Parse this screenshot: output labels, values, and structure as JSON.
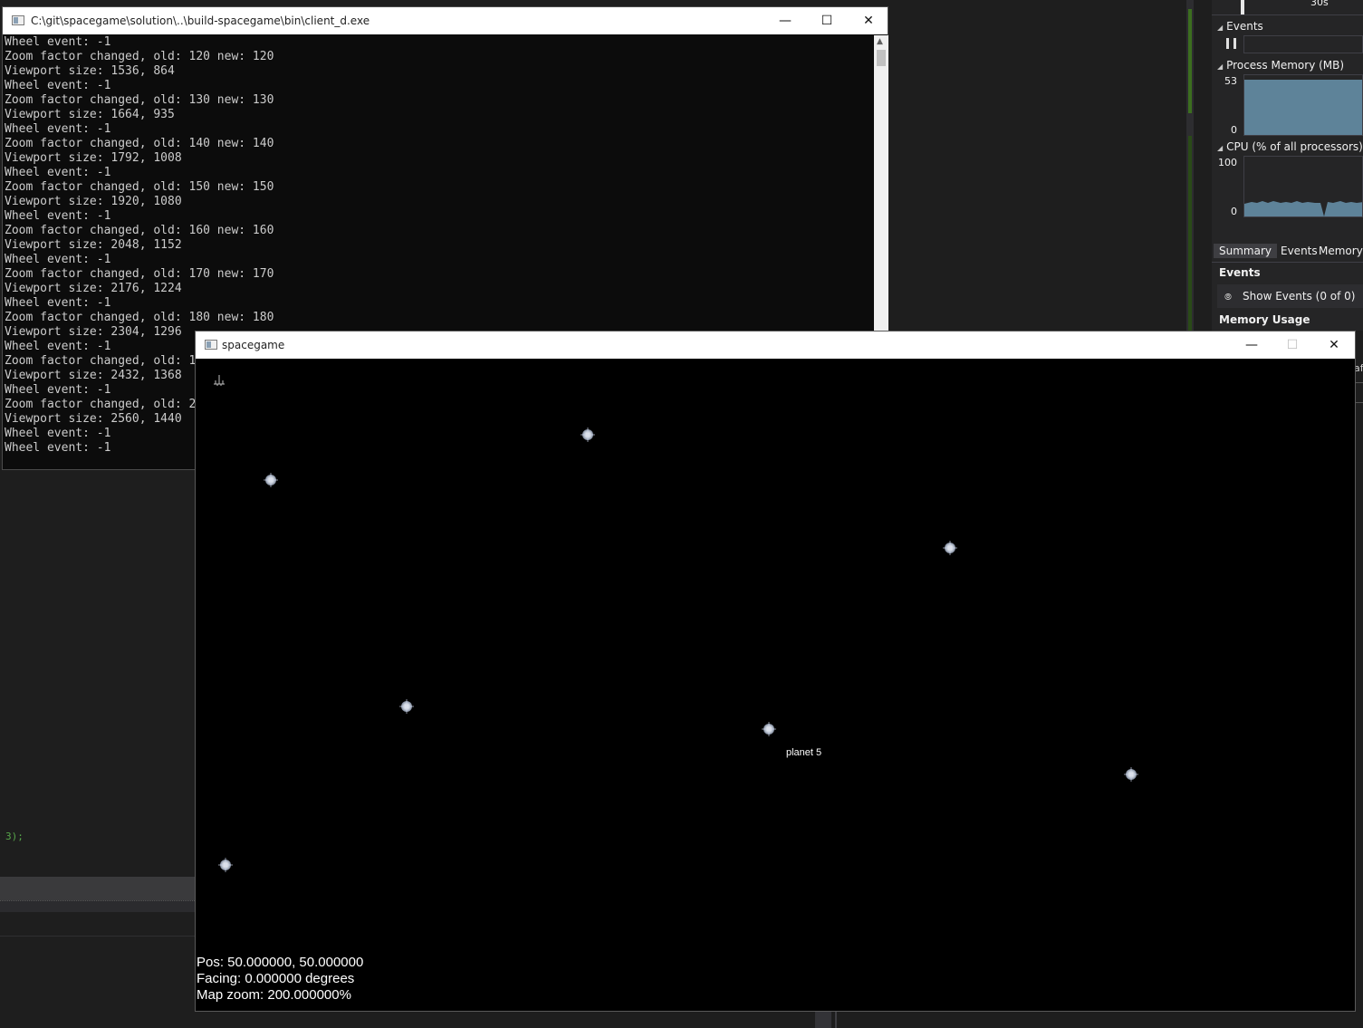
{
  "ide": {
    "code_fragment": "3);",
    "right_fragment": "af"
  },
  "diagnostics": {
    "timeline_label": "30s",
    "events_section": "Events",
    "process_memory": {
      "title": "Process Memory (MB)",
      "max": "53",
      "min": "0",
      "level": 0.93
    },
    "cpu": {
      "title": "CPU (% of all processors)",
      "max": "100",
      "min": "0"
    },
    "tabs": [
      "Summary",
      "Events",
      "Memory"
    ],
    "active_tab": "Summary",
    "events_header": "Events",
    "show_events": "Show Events (0 of 0)",
    "memory_usage": "Memory Usage"
  },
  "console_window": {
    "title": "C:\\git\\spacegame\\solution\\..\\build-spacegame\\bin\\client_d.exe",
    "lines": [
      "Wheel event: -1",
      "Zoom factor changed, old: 120 new: 120",
      "Viewport size: 1536, 864",
      "Wheel event: -1",
      "Zoom factor changed, old: 130 new: 130",
      "Viewport size: 1664, 935",
      "Wheel event: -1",
      "Zoom factor changed, old: 140 new: 140",
      "Viewport size: 1792, 1008",
      "Wheel event: -1",
      "Zoom factor changed, old: 150 new: 150",
      "Viewport size: 1920, 1080",
      "Wheel event: -1",
      "Zoom factor changed, old: 160 new: 160",
      "Viewport size: 2048, 1152",
      "Wheel event: -1",
      "Zoom factor changed, old: 170 new: 170",
      "Viewport size: 2176, 1224",
      "Wheel event: -1",
      "Zoom factor changed, old: 180 new: 180",
      "Viewport size: 2304, 1296",
      "Wheel event: -1",
      "Zoom factor changed, old: 1",
      "Viewport size: 2432, 1368",
      "Wheel event: -1",
      "Zoom factor changed, old: 2",
      "Viewport size: 2560, 1440",
      "Wheel event: -1",
      "Wheel event: -1"
    ]
  },
  "game_window": {
    "title": "spacegame",
    "planet_label": "planet 5",
    "hud": {
      "pos": "Pos: 50.000000, 50.000000",
      "facing": "Facing: 0.000000 degrees",
      "zoom": "Map zoom: 200.000000%"
    }
  },
  "window_buttons": {
    "minimize": "—",
    "maximize": "☐",
    "close": "✕"
  },
  "colors": {
    "graph_fill": "#5e8399",
    "console_bg": "#0c0c0c",
    "ide_bg": "#1e1e1e"
  }
}
